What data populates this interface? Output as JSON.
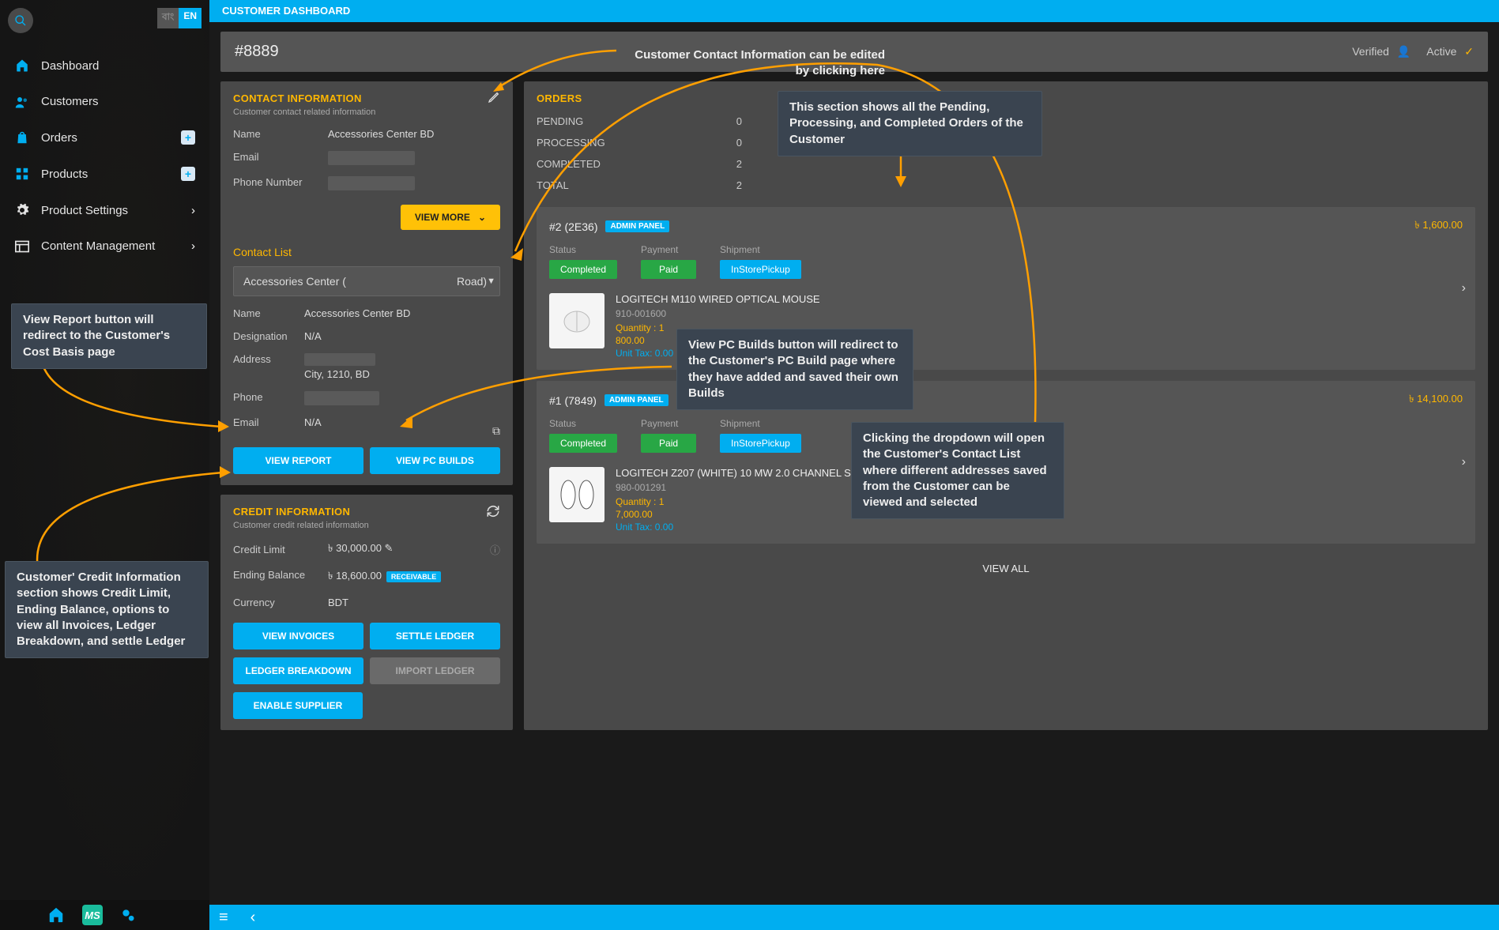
{
  "topbar": {
    "title": "CUSTOMER DASHBOARD"
  },
  "lang": {
    "bn": "বাং",
    "en": "EN"
  },
  "nav": {
    "items": [
      {
        "label": "Dashboard",
        "icon": "home"
      },
      {
        "label": "Customers",
        "icon": "users"
      },
      {
        "label": "Orders",
        "icon": "bag",
        "add": true
      },
      {
        "label": "Products",
        "icon": "grid",
        "add": true
      },
      {
        "label": "Product Settings",
        "icon": "gear",
        "chevron": true
      },
      {
        "label": "Content Management",
        "icon": "layout",
        "chevron": true
      }
    ]
  },
  "customer": {
    "id": "#8889",
    "verified": "Verified",
    "active": "Active"
  },
  "contact_info": {
    "title": "CONTACT INFORMATION",
    "subtitle": "Customer contact related information",
    "name_label": "Name",
    "name": "Accessories Center BD",
    "email_label": "Email",
    "phone_label": "Phone Number",
    "view_more": "VIEW MORE"
  },
  "contact_list": {
    "title": "Contact List",
    "selected": "Accessories Center (                                    Road)",
    "name_label": "Name",
    "name": "Accessories Center BD",
    "designation_label": "Designation",
    "designation": "N/A",
    "address_label": "Address",
    "address_line2": "City, 1210, BD",
    "phone_label": "Phone",
    "email_label": "Email",
    "email": "N/A",
    "view_report": "VIEW REPORT",
    "view_pc_builds": "VIEW PC BUILDS"
  },
  "credit_info": {
    "title": "CREDIT INFORMATION",
    "subtitle": "Customer credit related information",
    "credit_limit_label": "Credit Limit",
    "credit_limit": "৳  30,000.00",
    "ending_balance_label": "Ending Balance",
    "ending_balance": "৳  18,600.00",
    "receivable": "RECEIVABLE",
    "currency_label": "Currency",
    "currency": "BDT",
    "view_invoices": "VIEW INVOICES",
    "settle_ledger": "SETTLE LEDGER",
    "ledger_breakdown": "LEDGER BREAKDOWN",
    "import_ledger": "IMPORT LEDGER",
    "enable_supplier": "ENABLE SUPPLIER"
  },
  "orders": {
    "title": "ORDERS",
    "summary": [
      {
        "label": "PENDING",
        "value": "0"
      },
      {
        "label": "PROCESSING",
        "value": "0"
      },
      {
        "label": "COMPLETED",
        "value": "2"
      },
      {
        "label": "TOTAL",
        "value": "2"
      }
    ],
    "view_all": "VIEW ALL",
    "list": [
      {
        "number": "#2 (2E36)",
        "tag": "ADMIN PANEL",
        "price": "৳  1,600.00",
        "status_label": "Status",
        "payment_label": "Payment",
        "shipment_label": "Shipment",
        "status": "Completed",
        "payment": "Paid",
        "shipment": "InStorePickup",
        "product": {
          "name": "LOGITECH M110 WIRED OPTICAL MOUSE",
          "sku": "910-001600",
          "qty": "Quantity : 1",
          "price": "800.00",
          "tax": "Unit Tax: 0.00"
        }
      },
      {
        "number": "#1 (7849)",
        "tag": "ADMIN PANEL",
        "price": "৳  14,100.00",
        "status_label": "Status",
        "payment_label": "Payment",
        "shipment_label": "Shipment",
        "status": "Completed",
        "payment": "Paid",
        "shipment": "InStorePickup",
        "product": {
          "name": "LOGITECH Z207 (WHITE) 10 MW 2.0 CHANNEL SPEAKERS",
          "sku": "980-001291",
          "qty": "Quantity : 1",
          "price": "7,000.00",
          "tax": "Unit Tax: 0.00"
        }
      }
    ]
  },
  "callouts": {
    "c1": "Customer Contact Information can be edited by clicking here",
    "c2": "This section shows all the Pending, Processing, and Completed Orders of the Customer",
    "c3": "View Report button will redirect to the Customer's Cost Basis page",
    "c4": "View PC Builds button will redirect to the Customer's PC Build page where they have added and saved their own Builds",
    "c5": "Clicking the dropdown will open the Customer's Contact List where different addresses saved from the Customer can be viewed and selected",
    "c6": "Customer' Credit Information section shows Credit Limit, Ending Balance, options to view all Invoices, Ledger Breakdown, and settle Ledger"
  }
}
